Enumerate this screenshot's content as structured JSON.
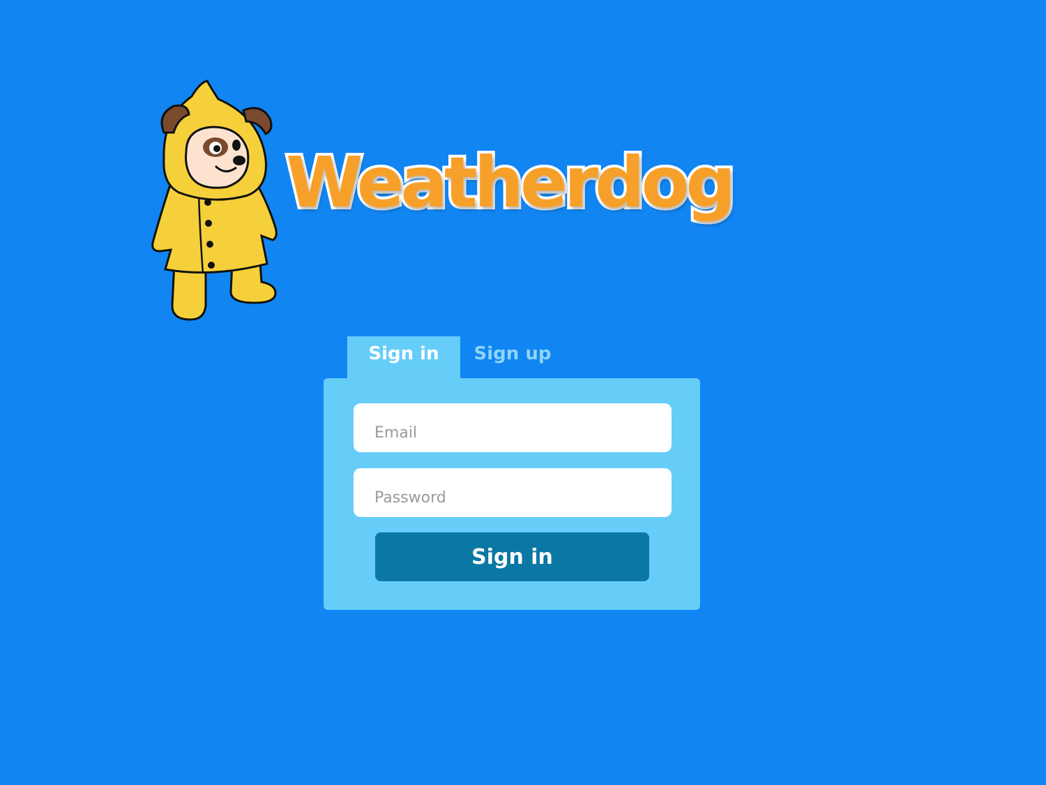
{
  "brand": {
    "name": "Weatherdog",
    "name_color": "#f7a029",
    "mascot_icon": "raincoat-dog-mascot"
  },
  "tabs": [
    {
      "label": "Sign in",
      "active": true
    },
    {
      "label": "Sign up",
      "active": false
    }
  ],
  "form": {
    "email_placeholder": "Email",
    "password_placeholder": "Password",
    "submit_label": "Sign in"
  },
  "colors": {
    "background": "#1185f2",
    "panel": "#66cdf9",
    "button": "#0b77a4",
    "raincoat": "#f6d03a"
  }
}
